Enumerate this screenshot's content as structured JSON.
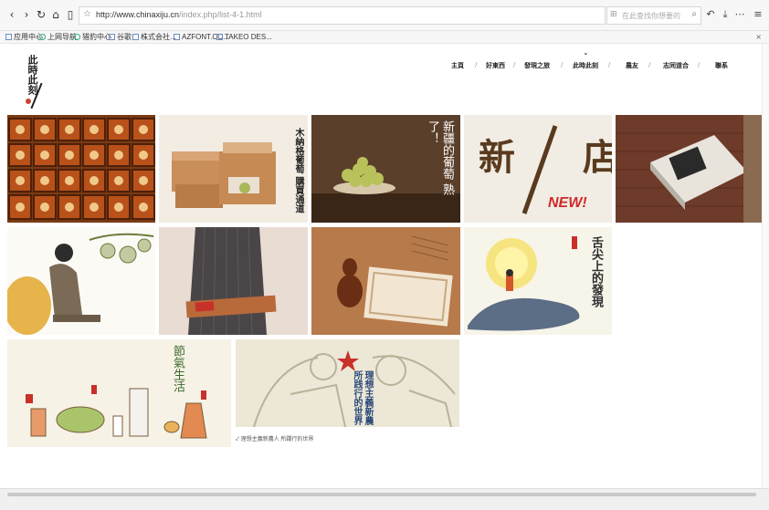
{
  "browser": {
    "url_main": "http://www.chinaxiju.cn",
    "url_path": "/index.php/list-4-1.html",
    "search_placeholder": "在此查找你想要的",
    "back_icon": "chevron-left-icon",
    "forward_icon": "chevron-right-icon",
    "reload_icon": "reload-icon",
    "home_icon": "home-icon"
  },
  "bookmarks": {
    "items": [
      {
        "label": "应用中心"
      },
      {
        "label": "上网导航"
      },
      {
        "label": "猎豹中心"
      },
      {
        "label": "谷歌"
      },
      {
        "label": "株式会社..."
      },
      {
        "label": "AZFONT.CO..."
      },
      {
        "label": "TAKEO DES..."
      }
    ]
  },
  "site": {
    "logo_text": "此時此刻",
    "nav_marker": "⌄",
    "nav": [
      "主頁",
      "好東西",
      "發現之旅",
      "此時此刻",
      "農友",
      "志同道合",
      "聯系"
    ]
  },
  "gallery": {
    "tiles": [
      {
        "name": "tile-honey-jars",
        "text": ""
      },
      {
        "name": "tile-grape-boxes",
        "text": "木納格葡萄 購買通道"
      },
      {
        "name": "tile-green-grapes",
        "text": "新疆的葡萄 熟了！"
      },
      {
        "name": "tile-new-store",
        "text": "新 店",
        "badge": "NEW!"
      },
      {
        "name": "tile-book",
        "text": ""
      },
      {
        "name": "tile-girl-illustration",
        "text": ""
      },
      {
        "name": "tile-person-package",
        "text": ""
      },
      {
        "name": "tile-gourd-carving",
        "text": ""
      },
      {
        "name": "tile-tongue-whale",
        "text": "舌尖上的發現"
      },
      {
        "name": "tile-seasonal-life",
        "text": "節氣生活"
      },
      {
        "name": "tile-idealism",
        "text": "理想主義新農 所践行的世界"
      }
    ],
    "caption": "✓ 理想主義新農人 所踐行的世界"
  }
}
